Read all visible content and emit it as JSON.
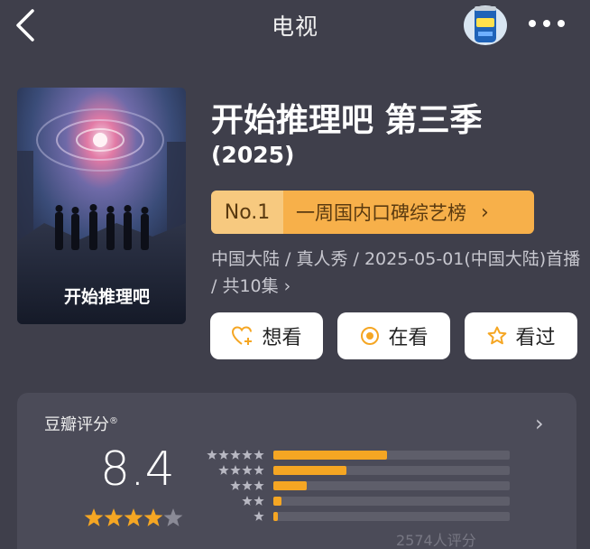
{
  "header": {
    "title": "电视",
    "back_icon": "chevron-left-icon",
    "menu_icon": "more-dots-icon",
    "mascot_icon": "beer-can-icon"
  },
  "poster": {
    "title_text": "开始推理吧"
  },
  "show": {
    "title": "开始推理吧 第三季",
    "year": "(2025)"
  },
  "rank": {
    "number": "No.1",
    "label": "一周国内口碑综艺榜",
    "chevron": "›"
  },
  "meta": {
    "text": "中国大陆 / 真人秀 / 2025-05-01(中国大陆)首播 / 共10集",
    "chevron": "›"
  },
  "actions": [
    {
      "label": "想看",
      "icon": "heart-plus-icon"
    },
    {
      "label": "在看",
      "icon": "target-icon"
    },
    {
      "label": "看过",
      "icon": "star-outline-icon"
    }
  ],
  "rating": {
    "label": "豆瓣评分",
    "mark": "®",
    "chevron": "›",
    "score": "8.4",
    "stars": 4,
    "distribution": [
      {
        "stars": 5,
        "fraction": 0.48
      },
      {
        "stars": 4,
        "fraction": 0.31
      },
      {
        "stars": 3,
        "fraction": 0.14
      },
      {
        "stars": 2,
        "fraction": 0.035
      },
      {
        "stars": 1,
        "fraction": 0.02
      }
    ],
    "count_text": "2574人评分"
  },
  "colors": {
    "background": "#3f3f4b",
    "accent": "#f5a623",
    "badge_left": "#f7c97f",
    "badge_right": "#f7b04a"
  }
}
